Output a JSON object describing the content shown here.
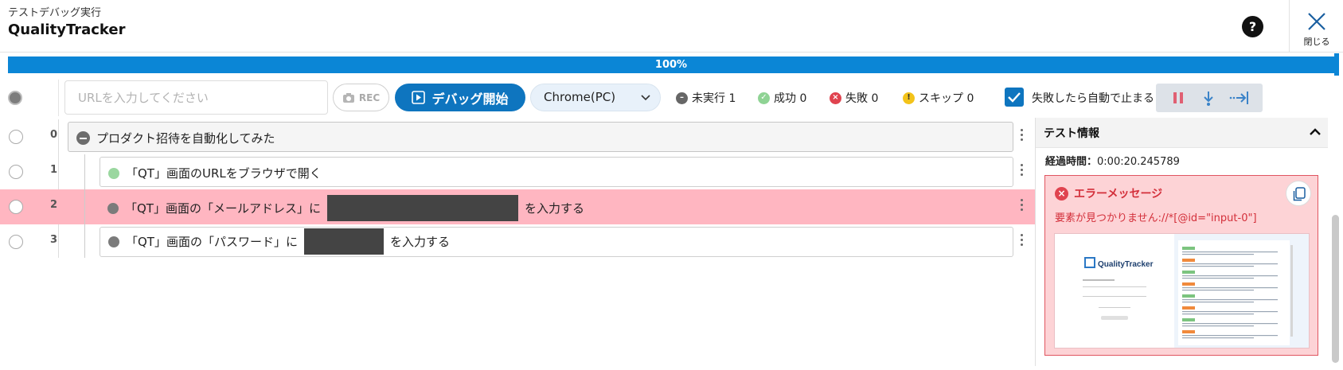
{
  "header": {
    "subtitle": "テストデバッグ実行",
    "app_title": "QualityTracker",
    "help_label": "?",
    "close_label": "閉じる"
  },
  "progress": {
    "percent_text": "100%",
    "value": 100
  },
  "toolbar": {
    "url_placeholder": "URLを入力してください",
    "url_value": "",
    "rec_label": "REC",
    "debug_label": "デバッグ開始",
    "browser_selected": "Chrome(PC)",
    "stats": {
      "not_run": "未実行 1",
      "success": "成功 0",
      "failed": "失敗 0",
      "skipped": "スキップ 0"
    },
    "stop_on_fail_label": "失敗したら自動で止まる",
    "stop_on_fail_checked": true
  },
  "steps": [
    {
      "num": "0",
      "text": "プロダクト招待を自動化してみた",
      "type": "group"
    },
    {
      "num": "1",
      "text": "「QT」画面のURLをブラウザで開く",
      "status": "success"
    },
    {
      "num": "2",
      "text_before": "「QT」画面の「メールアドレス」に",
      "text_after": "を入力する",
      "status": "error"
    },
    {
      "num": "3",
      "text_before": "「QT」画面の「パスワード」に",
      "text_after": "を入力する",
      "status": "pending"
    }
  ],
  "panel": {
    "title": "テスト情報",
    "elapsed_label": "経過時間：",
    "elapsed_value": "0:00:20.245789",
    "error_title": "エラーメッセージ",
    "error_message": "要素が見つかりません://*[@id=\"input-0\"]",
    "screenshot_logo": "QualityTracker"
  },
  "colors": {
    "accent": "#0e75bf",
    "progress": "#0b86d6",
    "error_row": "#ffb6c1",
    "error_text": "#d32f3a",
    "success": "#8fd394"
  }
}
